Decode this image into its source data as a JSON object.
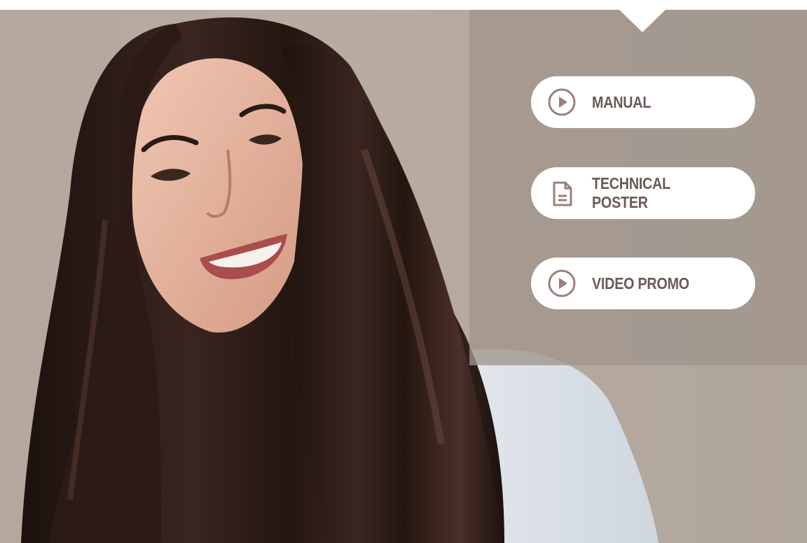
{
  "buttons": {
    "manual": {
      "label": "MANUAL",
      "icon": "play-circle-icon"
    },
    "poster": {
      "label": "TECHNICAL POSTER",
      "icon": "document-icon"
    },
    "video": {
      "label": "VIDEO PROMO",
      "icon": "play-circle-icon"
    }
  },
  "colors": {
    "background": "#b5aaa0",
    "panel": "#a0958c",
    "button": "#ffffff",
    "button_text": "#6b5a55",
    "icon": "#9a8178",
    "hair": "#2a1a16",
    "skin": "#e3b49f",
    "shirt": "#dde3ea"
  }
}
